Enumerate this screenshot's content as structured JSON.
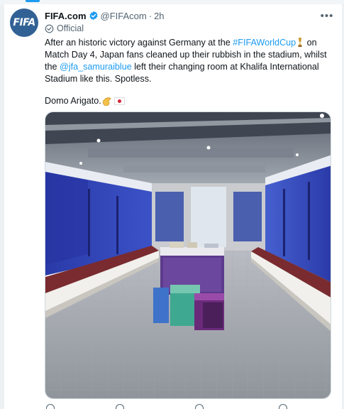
{
  "author": {
    "name": "FIFA.com",
    "handle": "@FIFAcom",
    "separator": "·",
    "time": "2h",
    "avatar_text": "FIFA",
    "verified": true,
    "label": "Official"
  },
  "icons": {
    "verified": "verified-badge-icon",
    "official": "official-badge-icon",
    "more": "more-options-icon"
  },
  "more_label": "•••",
  "tweet": {
    "part1": "After an historic victory against Germany at the ",
    "hashtag": "#FIFAWorldCup",
    "part2": " on Match Day 4, Japan fans cleaned up their rubbish in the stadium, whilst the ",
    "mention": "@jfa_samuraiblue",
    "part3": " left their changing room at Khalifa International Stadium like this. Spotless.",
    "signoff": "Domo Arigato."
  },
  "colors": {
    "accent": "#1d9bf0",
    "text": "#0f1419",
    "muted": "#536471",
    "avatar_bg": "#326295"
  }
}
